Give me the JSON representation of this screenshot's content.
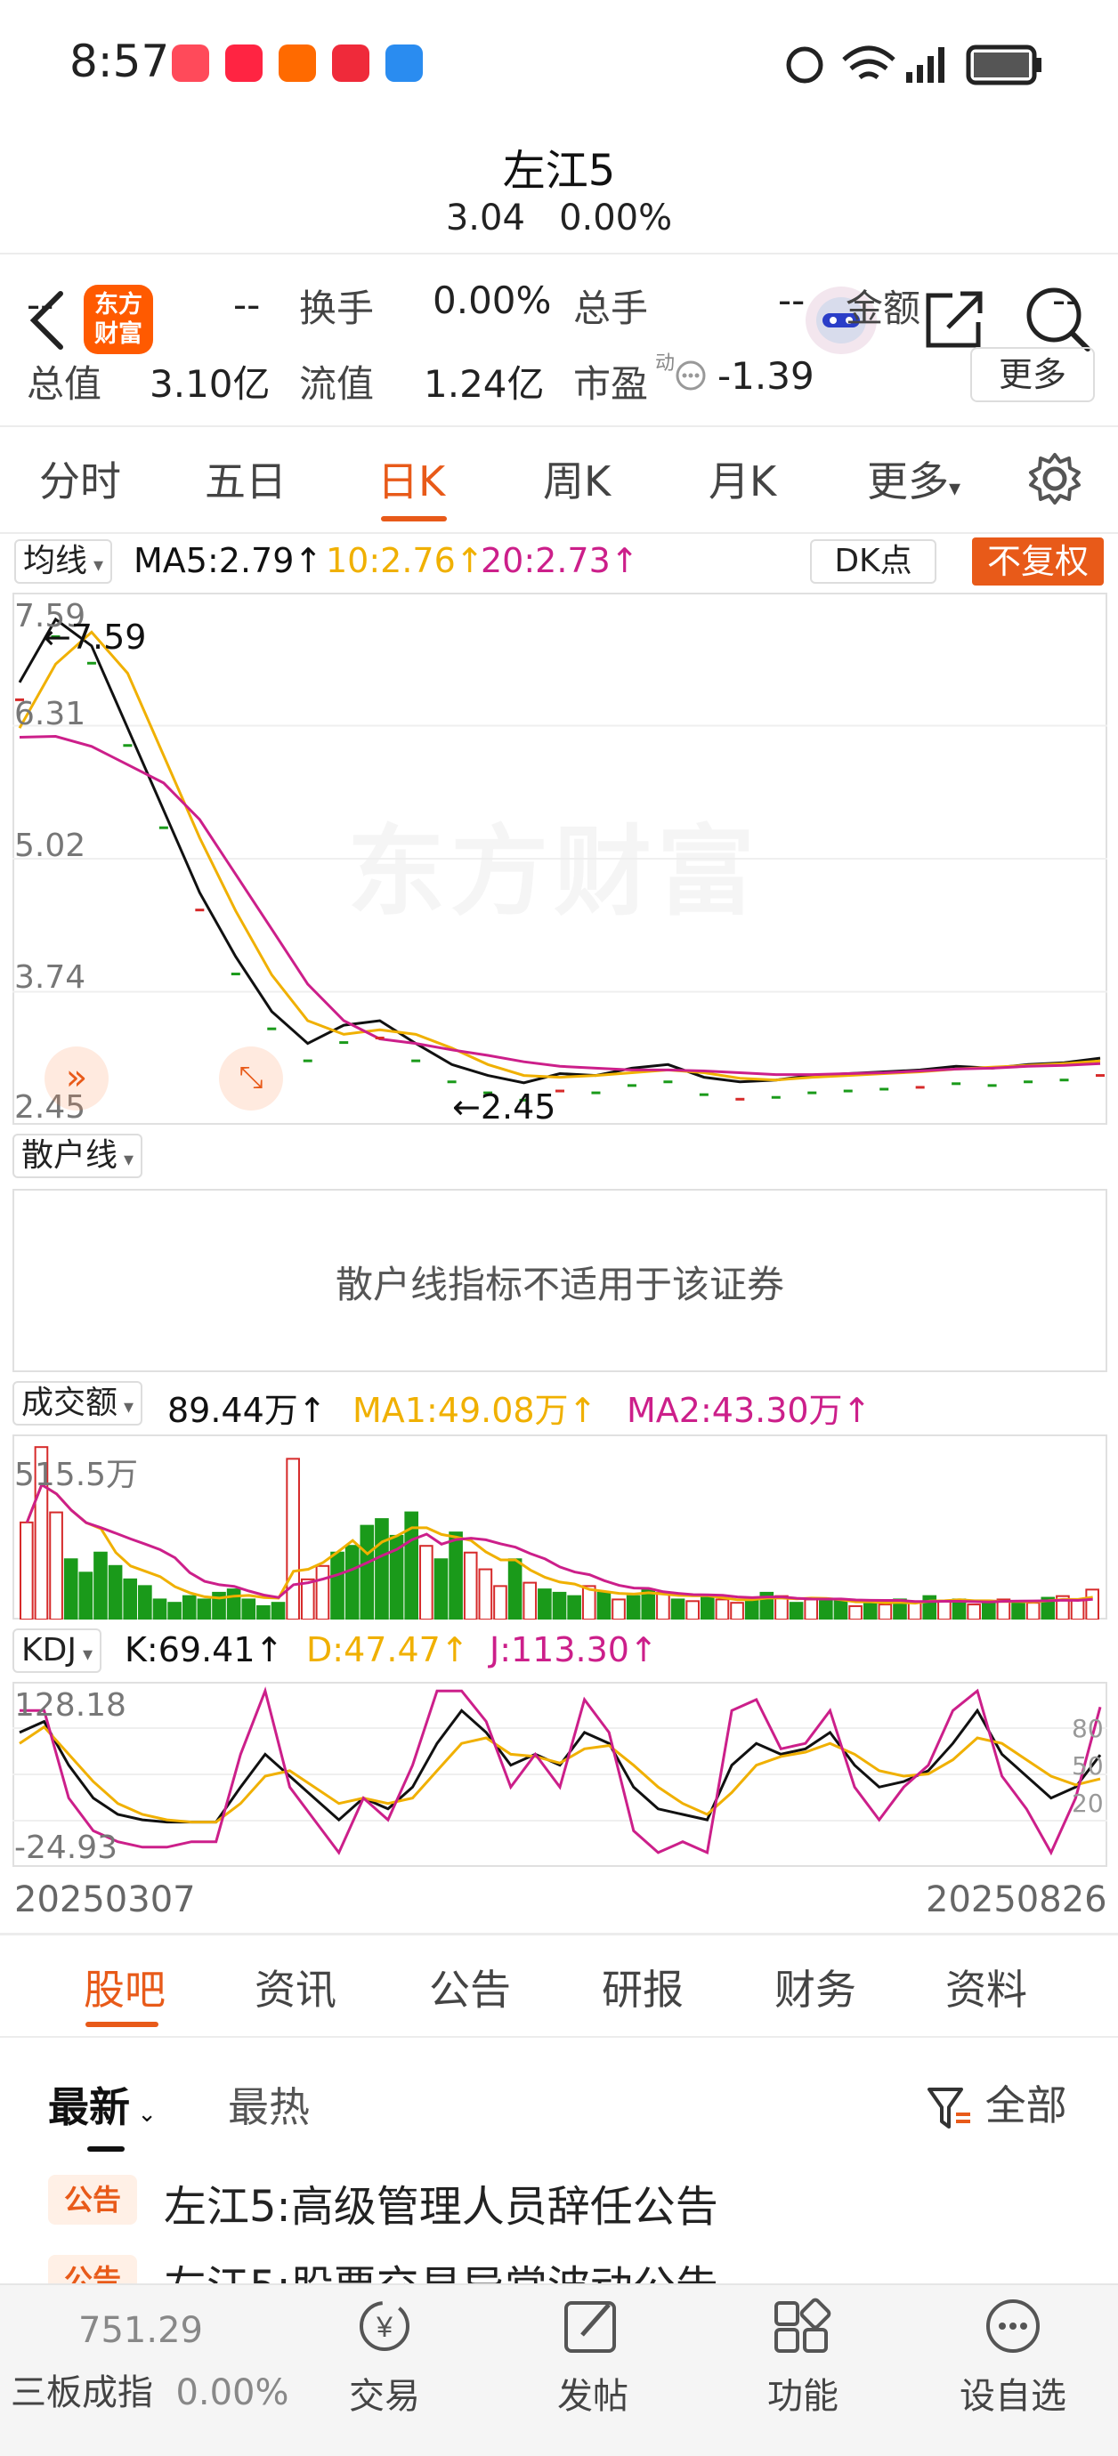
{
  "status": {
    "time": "8:57",
    "app_icon_label": "小红书",
    "huawei_label": "HUAWEI"
  },
  "header": {
    "stock_name": "左江5",
    "price": "3.04",
    "change_pct": "0.00%",
    "logo_line1": "东方",
    "logo_line2": "财富"
  },
  "quote": {
    "row1": {
      "c1": "--",
      "c2": "--",
      "turnover_label": "换手",
      "turnover_value": "0.00%",
      "volume_label": "总手",
      "volume_value": "--",
      "amount_label": "金额",
      "amount_value": "--"
    },
    "row2": {
      "mktcap_label": "总值",
      "mktcap_value": "3.10亿",
      "float_label": "流值",
      "float_value": "1.24亿",
      "pe_label": "市盈",
      "pe_sup": "动",
      "pe_value": "-1.39",
      "more_button": "更多"
    }
  },
  "tabs": [
    "分时",
    "五日",
    "日K",
    "周K",
    "月K",
    "更多"
  ],
  "active_tab": "日K",
  "kline": {
    "indicator_select": "均线",
    "ma5": "MA5:2.79",
    "ma10": "10:2.76",
    "ma20": "20:2.73",
    "dk_button": "DK点",
    "adjust_button": "不复权",
    "y_ticks": [
      "7.59",
      "6.31",
      "5.02",
      "3.74",
      "2.45"
    ],
    "max_label": "7.59",
    "min_label": "2.45",
    "watermark": "东方财富",
    "colors": {
      "ma5": "#111111",
      "ma10": "#f0b000",
      "ma20": "#cc1f8a",
      "up": "#d62a2a",
      "down": "#1a9a1a"
    }
  },
  "retail": {
    "select": "散户线",
    "message": "散户线指标不适用于该证券"
  },
  "volume": {
    "select": "成交额",
    "value": "89.44万",
    "ma1": "MA1:49.08万",
    "ma2": "MA2:43.30万",
    "max_label": "515.5万"
  },
  "kdj": {
    "select": "KDJ",
    "k": "K:69.41",
    "d": "D:47.47",
    "j": "J:113.30",
    "y_top": "128.18",
    "y_bottom": "-24.93",
    "right_ticks": [
      "80",
      "50",
      "20"
    ]
  },
  "dates": {
    "start": "20250307",
    "end": "20250826"
  },
  "bottom_tabs": [
    "股吧",
    "资讯",
    "公告",
    "研报",
    "财务",
    "资料"
  ],
  "active_bottom_tab": "股吧",
  "feed": {
    "sort_latest": "最新",
    "sort_hot": "最热",
    "filter": "全部",
    "items": [
      {
        "badge": "公告",
        "text": "左江5:高级管理人员辞任公告"
      },
      {
        "badge": "公告",
        "text": "左江5:股票交易异常波动公告"
      }
    ]
  },
  "footer": {
    "index_value": "751.29",
    "index_name": "三板成指",
    "index_change": "0.00%",
    "buttons": [
      "交易",
      "发帖",
      "功能",
      "设自选"
    ]
  },
  "chart_data": [
    {
      "type": "line",
      "title": "",
      "ylim": [
        2.45,
        7.59
      ],
      "series": [
        {
          "name": "MA5",
          "values": [
            6.9,
            7.59,
            7.3,
            6.4,
            5.5,
            4.6,
            3.9,
            3.3,
            2.95,
            3.15,
            3.2,
            2.95,
            2.72,
            2.6,
            2.52,
            2.62,
            2.6,
            2.68,
            2.72,
            2.58,
            2.53,
            2.55,
            2.6,
            2.62,
            2.64,
            2.66,
            2.7,
            2.68,
            2.72,
            2.74,
            2.79
          ]
        },
        {
          "name": "MA10",
          "values": [
            6.4,
            7.1,
            7.45,
            7.0,
            6.1,
            5.2,
            4.4,
            3.7,
            3.2,
            3.05,
            3.1,
            3.05,
            2.9,
            2.72,
            2.6,
            2.58,
            2.6,
            2.63,
            2.66,
            2.63,
            2.57,
            2.55,
            2.58,
            2.6,
            2.62,
            2.64,
            2.67,
            2.69,
            2.71,
            2.73,
            2.76
          ]
        },
        {
          "name": "MA20",
          "values": [
            6.3,
            6.31,
            6.2,
            6.0,
            5.8,
            5.4,
            4.8,
            4.2,
            3.6,
            3.2,
            3.0,
            2.95,
            2.88,
            2.82,
            2.75,
            2.7,
            2.68,
            2.66,
            2.66,
            2.65,
            2.63,
            2.61,
            2.61,
            2.62,
            2.63,
            2.65,
            2.67,
            2.68,
            2.7,
            2.71,
            2.73
          ]
        }
      ]
    },
    {
      "type": "bar",
      "title": "",
      "ylim": [
        0,
        515.5
      ],
      "values": [
        290,
        515,
        320,
        180,
        140,
        200,
        160,
        120,
        100,
        60,
        50,
        70,
        60,
        80,
        90,
        60,
        40,
        50,
        480,
        120,
        160,
        200,
        220,
        280,
        300,
        250,
        320,
        220,
        180,
        260,
        200,
        150,
        100,
        180,
        110,
        90,
        80,
        70,
        100,
        80,
        60,
        70,
        90,
        80,
        60,
        55,
        70,
        60,
        50,
        60,
        80,
        70,
        50,
        60,
        55,
        60,
        40,
        50,
        45,
        60,
        50,
        70,
        55,
        60,
        45,
        50,
        60,
        55,
        50,
        65,
        70,
        60,
        89.44
      ],
      "up_flags": [
        1,
        1,
        1,
        0,
        0,
        0,
        0,
        0,
        0,
        0,
        0,
        0,
        0,
        0,
        0,
        0,
        0,
        0,
        1,
        1,
        1,
        0,
        0,
        0,
        0,
        0,
        0,
        1,
        0,
        0,
        1,
        1,
        1,
        0,
        1,
        0,
        0,
        0,
        1,
        0,
        1,
        0,
        0,
        1,
        0,
        1,
        0,
        1,
        1,
        0,
        0,
        1,
        0,
        1,
        0,
        0,
        1,
        0,
        1,
        0,
        1,
        0,
        1,
        0,
        1,
        0,
        1,
        0,
        1,
        0,
        1,
        1,
        1
      ]
    },
    {
      "type": "line",
      "title": "",
      "ylim": [
        -24.93,
        128.18
      ],
      "series": [
        {
          "name": "K",
          "values": [
            90,
            100,
            60,
            30,
            15,
            10,
            8,
            8,
            8,
            40,
            70,
            50,
            30,
            10,
            30,
            20,
            40,
            80,
            110,
            90,
            60,
            70,
            60,
            90,
            80,
            40,
            20,
            15,
            10,
            60,
            80,
            70,
            75,
            90,
            60,
            40,
            45,
            55,
            80,
            110,
            70,
            50,
            30,
            40,
            69.41
          ]
        },
        {
          "name": "D",
          "values": [
            80,
            95,
            70,
            45,
            25,
            15,
            10,
            8,
            8,
            25,
            50,
            55,
            40,
            25,
            30,
            25,
            30,
            55,
            80,
            85,
            70,
            68,
            62,
            75,
            78,
            60,
            40,
            25,
            15,
            35,
            60,
            68,
            72,
            80,
            70,
            55,
            50,
            52,
            65,
            85,
            80,
            65,
            50,
            42,
            47.47
          ]
        },
        {
          "name": "J",
          "values": [
            110,
            110,
            30,
            0,
            -10,
            -15,
            -15,
            -10,
            -10,
            70,
            128,
            40,
            10,
            -20,
            30,
            10,
            60,
            128,
            128,
            100,
            40,
            70,
            40,
            120,
            90,
            0,
            -20,
            -10,
            -20,
            110,
            120,
            75,
            80,
            110,
            40,
            10,
            40,
            60,
            110,
            128,
            50,
            20,
            -20,
            30,
            113.3
          ]
        }
      ]
    }
  ]
}
